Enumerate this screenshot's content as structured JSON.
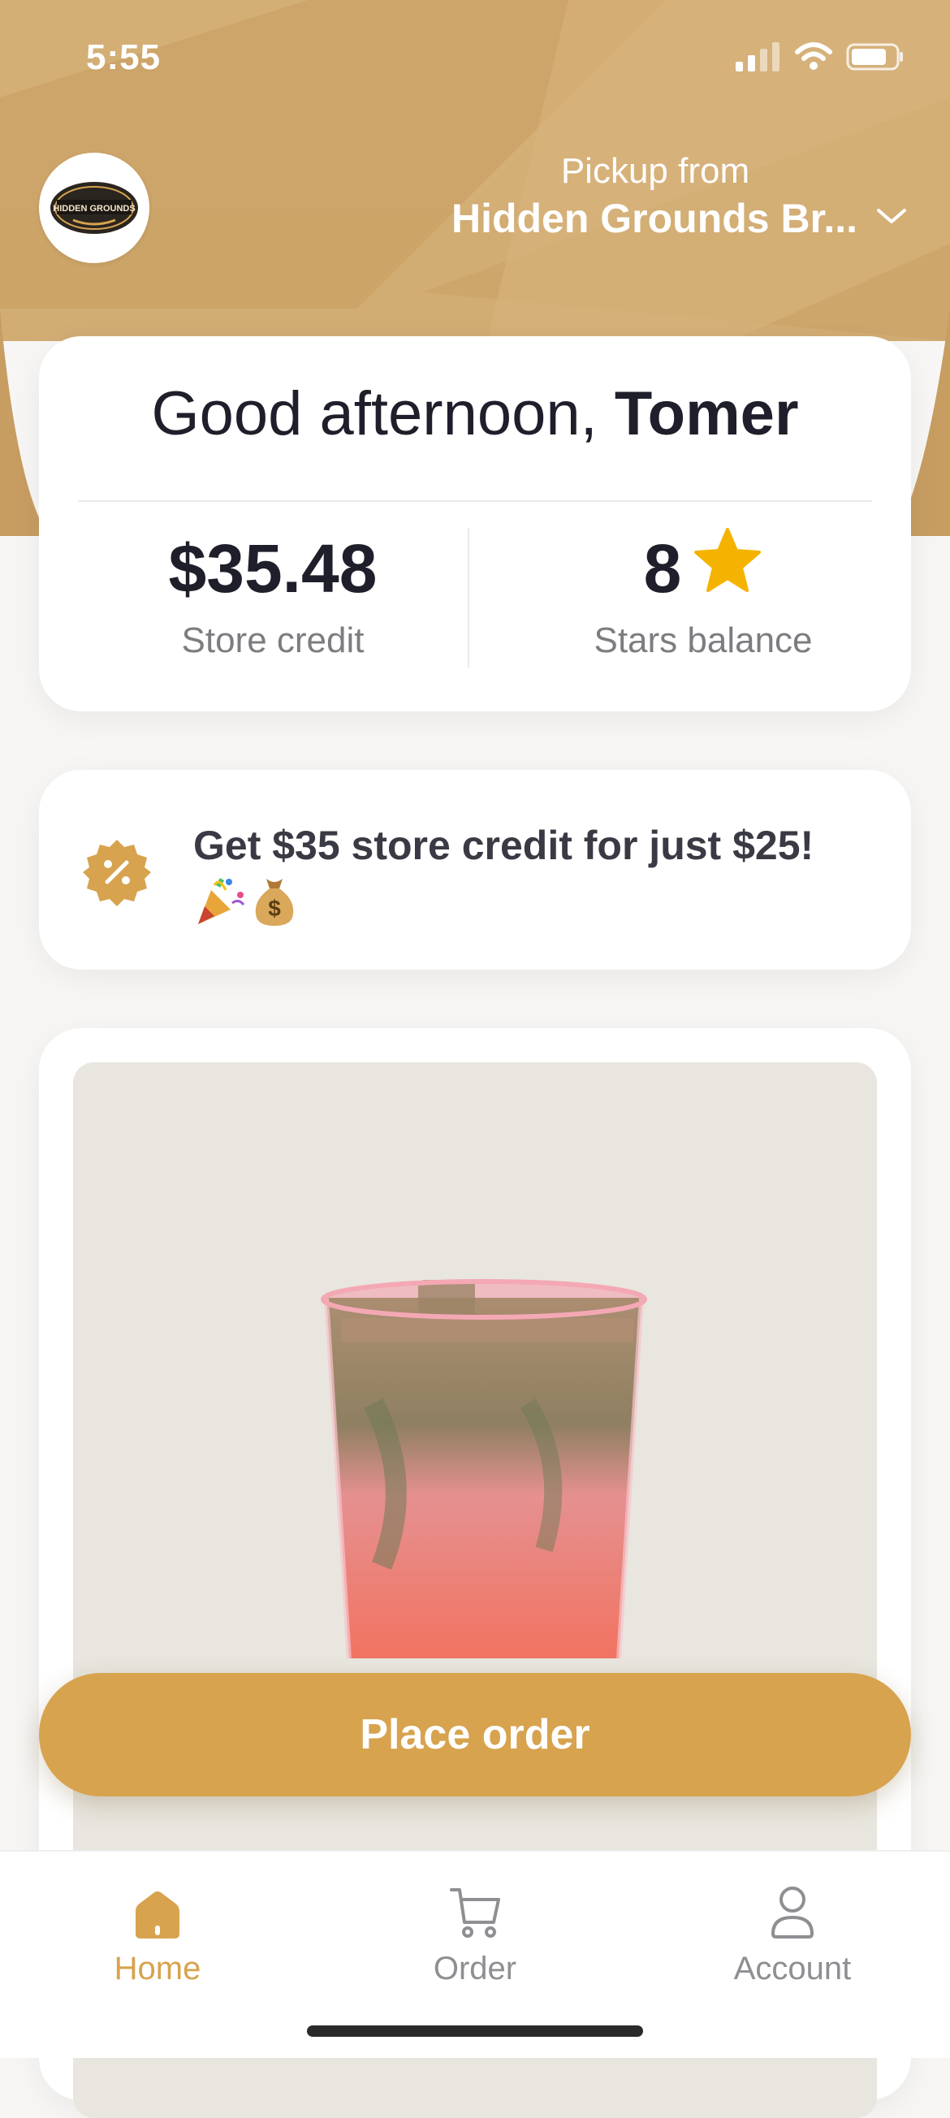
{
  "status_bar": {
    "time": "5:55"
  },
  "header": {
    "logo_text": "HIDDEN GROUNDS",
    "pickup_label": "Pickup from",
    "pickup_store": "Hidden Grounds Br..."
  },
  "greeting_card": {
    "greeting_prefix": "Good afternoon, ",
    "user_name": "Tomer",
    "store_credit_value": "$35.48",
    "store_credit_label": "Store credit",
    "stars_value": "8",
    "stars_label": "Stars balance"
  },
  "promo": {
    "text": "Get $35 store credit for just $25!",
    "emoji": "🎉💰"
  },
  "actions": {
    "place_order_label": "Place order"
  },
  "tabbar": {
    "items": [
      {
        "label": "Home",
        "icon": "home-icon",
        "active": true
      },
      {
        "label": "Order",
        "icon": "cart-icon",
        "active": false
      },
      {
        "label": "Account",
        "icon": "user-icon",
        "active": false
      }
    ]
  },
  "colors": {
    "accent": "#d7a34e",
    "header_gold": "#c9a066",
    "text_dark": "#1f1f2b",
    "text_muted": "#7d7c80",
    "star": "#f5b301"
  }
}
